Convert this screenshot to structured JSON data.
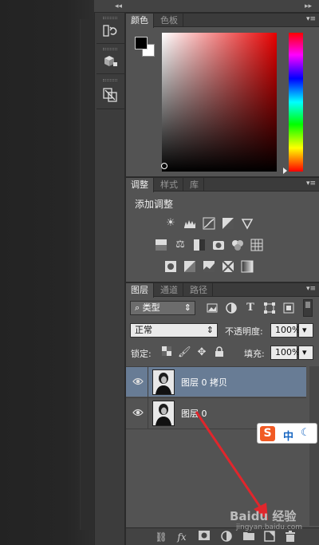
{
  "color_panel": {
    "tabs": [
      "颜色",
      "色板"
    ],
    "foreground": "#000000",
    "background": "#ffffff",
    "hue_color": "#e60000"
  },
  "adjust_panel": {
    "tabs": [
      "调整",
      "样式",
      "库"
    ],
    "heading": "添加调整"
  },
  "layers_panel": {
    "tabs": [
      "图层",
      "通道",
      "路径"
    ],
    "filter_kind": "类型",
    "blend_mode": "正常",
    "opacity_label": "不透明度:",
    "opacity_value": "100%",
    "lock_label": "锁定:",
    "fill_label": "填充:",
    "fill_value": "100%",
    "layers": [
      {
        "name": "图层 0 拷贝",
        "selected": true
      },
      {
        "name": "图层 0",
        "selected": false
      }
    ],
    "footer_fx": "fx"
  },
  "ime": {
    "label": "中"
  },
  "watermark": {
    "text": "Baidu 经验",
    "url": "jingyan.baidu.com"
  },
  "annotation_color": "#e0262c"
}
